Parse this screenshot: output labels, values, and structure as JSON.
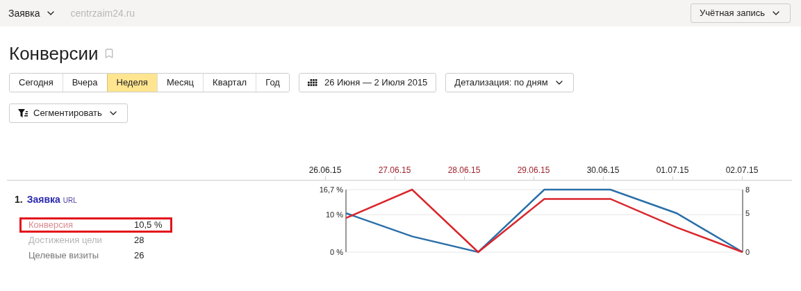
{
  "top_bar": {
    "counter_menu": "Заявка",
    "site": "centrzaim24.ru",
    "account_button": "Учётная запись"
  },
  "title": "Конверсии",
  "period_tabs": [
    {
      "label": "Сегодня",
      "selected": false
    },
    {
      "label": "Вчера",
      "selected": false
    },
    {
      "label": "Неделя",
      "selected": true
    },
    {
      "label": "Месяц",
      "selected": false
    },
    {
      "label": "Квартал",
      "selected": false
    },
    {
      "label": "Год",
      "selected": false
    }
  ],
  "date_range": "26 Июня — 2 Июля 2015",
  "detail_button": "Детализация: по дням",
  "segment_button": "Сегментировать",
  "timeline": [
    {
      "label": "26.06.15",
      "color": "#222222"
    },
    {
      "label": "27.06.15",
      "color": "#a0242c"
    },
    {
      "label": "28.06.15",
      "color": "#a0242c"
    },
    {
      "label": "29.06.15",
      "color": "#a0242c"
    },
    {
      "label": "30.06.15",
      "color": "#222222"
    },
    {
      "label": "01.07.15",
      "color": "#222222"
    },
    {
      "label": "02.07.15",
      "color": "#222222"
    }
  ],
  "goal": {
    "number": "1.",
    "name": "Заявка",
    "tag": "URL",
    "metrics": [
      {
        "label": "Конверсия",
        "value": "10,5 %",
        "color": "#d98a90",
        "highlighted": true
      },
      {
        "label": "Достижения цели",
        "value": "28",
        "color": "#b4b4b4",
        "highlighted": false
      },
      {
        "label": "Целевые визиты",
        "value": "26",
        "color": "#777777",
        "highlighted": false
      }
    ],
    "chart": {
      "chart_data": {
        "type": "line",
        "ylim": [
          0,
          16.7
        ],
        "yticks": [
          {
            "value": 0,
            "label": "0 %"
          },
          {
            "value": 10,
            "label": "10 %"
          },
          {
            "value": 16.7,
            "label": "16,7 %"
          }
        ],
        "series": [
          {
            "color": "#d9262c",
            "values": [
              9.1,
              16.7,
              0,
              14.2,
              14.2,
              6.6,
              0
            ]
          },
          {
            "color": "#2a6fa8",
            "values": [
              10.4,
              4.2,
              0,
              16.7,
              16.7,
              10.4,
              0
            ]
          }
        ]
      },
      "right_ticks": [
        "8",
        "5",
        "0"
      ]
    }
  }
}
